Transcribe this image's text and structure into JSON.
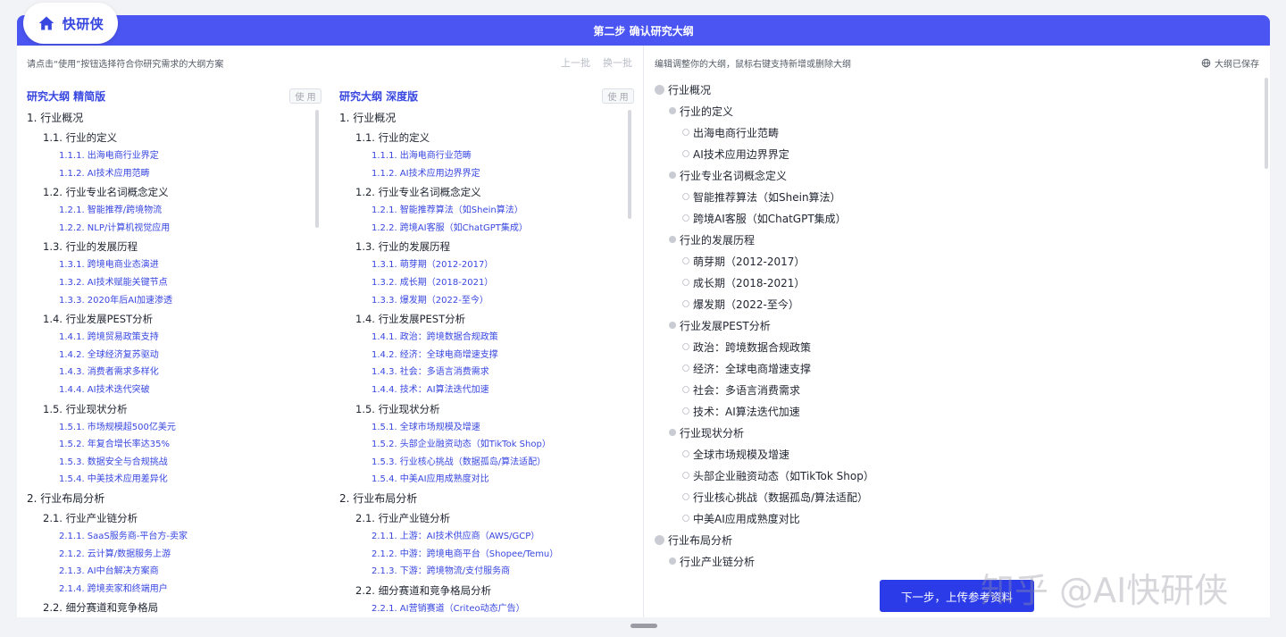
{
  "app": {
    "logo_text": "快研侠",
    "step_title": "第二步 确认研究大纲"
  },
  "left": {
    "hint": "请点击“使用”按钮选择符合你研究需求的大纲方案",
    "prev_batch": "上一批",
    "next_batch": "换一批",
    "use_label": "使 用",
    "col1": {
      "title": "研究大纲 精简版",
      "lines": [
        {
          "lv": 1,
          "text": "1. 行业概况"
        },
        {
          "lv": 2,
          "text": "1.1. 行业的定义"
        },
        {
          "lv": 3,
          "text": "1.1.1. 出海电商行业界定"
        },
        {
          "lv": 3,
          "text": "1.1.2. AI技术应用范畴"
        },
        {
          "lv": 2,
          "text": "1.2. 行业专业名词概念定义"
        },
        {
          "lv": 3,
          "text": "1.2.1. 智能推荐/跨境物流"
        },
        {
          "lv": 3,
          "text": "1.2.2. NLP/计算机视觉应用"
        },
        {
          "lv": 2,
          "text": "1.3. 行业的发展历程"
        },
        {
          "lv": 3,
          "text": "1.3.1. 跨境电商业态演进"
        },
        {
          "lv": 3,
          "text": "1.3.2. AI技术赋能关键节点"
        },
        {
          "lv": 3,
          "text": "1.3.3. 2020年后AI加速渗透"
        },
        {
          "lv": 2,
          "text": "1.4. 行业发展PEST分析"
        },
        {
          "lv": 3,
          "text": "1.4.1. 跨境贸易政策支持"
        },
        {
          "lv": 3,
          "text": "1.4.2. 全球经济复苏驱动"
        },
        {
          "lv": 3,
          "text": "1.4.3. 消费者需求多样化"
        },
        {
          "lv": 3,
          "text": "1.4.4. AI技术迭代突破"
        },
        {
          "lv": 2,
          "text": "1.5. 行业现状分析"
        },
        {
          "lv": 3,
          "text": "1.5.1. 市场规模超500亿美元"
        },
        {
          "lv": 3,
          "text": "1.5.2. 年复合增长率达35%"
        },
        {
          "lv": 3,
          "text": "1.5.3. 数据安全与合规挑战"
        },
        {
          "lv": 3,
          "text": "1.5.4. 中美技术应用差异化"
        },
        {
          "lv": 1,
          "text": "2. 行业布局分析"
        },
        {
          "lv": 2,
          "text": "2.1. 行业产业链分析"
        },
        {
          "lv": 3,
          "text": "2.1.1. SaaS服务商-平台方-卖家"
        },
        {
          "lv": 3,
          "text": "2.1.2. 云计算/数据服务上游"
        },
        {
          "lv": 3,
          "text": "2.1.3. AI中台解决方案商"
        },
        {
          "lv": 3,
          "text": "2.1.4. 跨境卖家和终端用户"
        },
        {
          "lv": 2,
          "text": "2.2. 细分赛道和竞争格局"
        }
      ]
    },
    "col2": {
      "title": "研究大纲 深度版",
      "lines": [
        {
          "lv": 1,
          "text": "1. 行业概况"
        },
        {
          "lv": 2,
          "text": "1.1. 行业的定义"
        },
        {
          "lv": 3,
          "text": "1.1.1. 出海电商行业范畴"
        },
        {
          "lv": 3,
          "text": "1.1.2. AI技术应用边界界定"
        },
        {
          "lv": 2,
          "text": "1.2. 行业专业名词概念定义"
        },
        {
          "lv": 3,
          "text": "1.2.1. 智能推荐算法（如Shein算法）"
        },
        {
          "lv": 3,
          "text": "1.2.2. 跨境AI客服（如ChatGPT集成）"
        },
        {
          "lv": 2,
          "text": "1.3. 行业的发展历程"
        },
        {
          "lv": 3,
          "text": "1.3.1. 萌芽期（2012-2017）"
        },
        {
          "lv": 3,
          "text": "1.3.2. 成长期（2018-2021）"
        },
        {
          "lv": 3,
          "text": "1.3.3. 爆发期（2022-至今）"
        },
        {
          "lv": 2,
          "text": "1.4. 行业发展PEST分析"
        },
        {
          "lv": 3,
          "text": "1.4.1. 政治：跨境数据合规政策"
        },
        {
          "lv": 3,
          "text": "1.4.2. 经济：全球电商增速支撑"
        },
        {
          "lv": 3,
          "text": "1.4.3. 社会：多语言消费需求"
        },
        {
          "lv": 3,
          "text": "1.4.4. 技术：AI算法迭代加速"
        },
        {
          "lv": 2,
          "text": "1.5. 行业现状分析"
        },
        {
          "lv": 3,
          "text": "1.5.1. 全球市场规模及增速"
        },
        {
          "lv": 3,
          "text": "1.5.2. 头部企业融资动态（如TikTok Shop）"
        },
        {
          "lv": 3,
          "text": "1.5.3. 行业核心挑战（数据孤岛/算法适配）"
        },
        {
          "lv": 3,
          "text": "1.5.4. 中美AI应用成熟度对比"
        },
        {
          "lv": 1,
          "text": "2. 行业布局分析"
        },
        {
          "lv": 2,
          "text": "2.1. 行业产业链分析"
        },
        {
          "lv": 3,
          "text": "2.1.1. 上游：AI技术供应商（AWS/GCP）"
        },
        {
          "lv": 3,
          "text": "2.1.2. 中游：跨境电商平台（Shopee/Temu）"
        },
        {
          "lv": 3,
          "text": "2.1.3. 下游：跨境物流/支付服务商"
        },
        {
          "lv": 2,
          "text": "2.2. 细分赛道和竞争格局分析"
        },
        {
          "lv": 3,
          "text": "2.2.1. AI营销赛道（Criteo动态广告）"
        }
      ]
    }
  },
  "right": {
    "hint": "编辑调整你的大纲，鼠标右键支持新增或删除大纲",
    "saved": "大纲已保存",
    "tree": [
      {
        "lv": 1,
        "text": "行业概况"
      },
      {
        "lv": 2,
        "text": "行业的定义"
      },
      {
        "lv": 3,
        "text": "出海电商行业范畴"
      },
      {
        "lv": 3,
        "text": "AI技术应用边界界定"
      },
      {
        "lv": 2,
        "text": "行业专业名词概念定义"
      },
      {
        "lv": 3,
        "text": "智能推荐算法（如Shein算法）"
      },
      {
        "lv": 3,
        "text": "跨境AI客服（如ChatGPT集成）"
      },
      {
        "lv": 2,
        "text": "行业的发展历程"
      },
      {
        "lv": 3,
        "text": "萌芽期（2012-2017）"
      },
      {
        "lv": 3,
        "text": "成长期（2018-2021）"
      },
      {
        "lv": 3,
        "text": "爆发期（2022-至今）"
      },
      {
        "lv": 2,
        "text": "行业发展PEST分析"
      },
      {
        "lv": 3,
        "text": "政治：跨境数据合规政策"
      },
      {
        "lv": 3,
        "text": "经济：全球电商增速支撑"
      },
      {
        "lv": 3,
        "text": "社会：多语言消费需求"
      },
      {
        "lv": 3,
        "text": "技术：AI算法迭代加速"
      },
      {
        "lv": 2,
        "text": "行业现状分析"
      },
      {
        "lv": 3,
        "text": "全球市场规模及增速"
      },
      {
        "lv": 3,
        "text": "头部企业融资动态（如TikTok Shop）"
      },
      {
        "lv": 3,
        "text": "行业核心挑战（数据孤岛/算法适配）"
      },
      {
        "lv": 3,
        "text": "中美AI应用成熟度对比"
      },
      {
        "lv": 1,
        "text": "行业布局分析"
      },
      {
        "lv": 2,
        "text": "行业产业链分析"
      }
    ],
    "next_button": "下一步，上传参考资料"
  },
  "watermark": "知乎 @AI快研侠",
  "colors": {
    "primary": "#4b55f2",
    "accent_text": "#3847e0",
    "button": "#2c3be8"
  }
}
